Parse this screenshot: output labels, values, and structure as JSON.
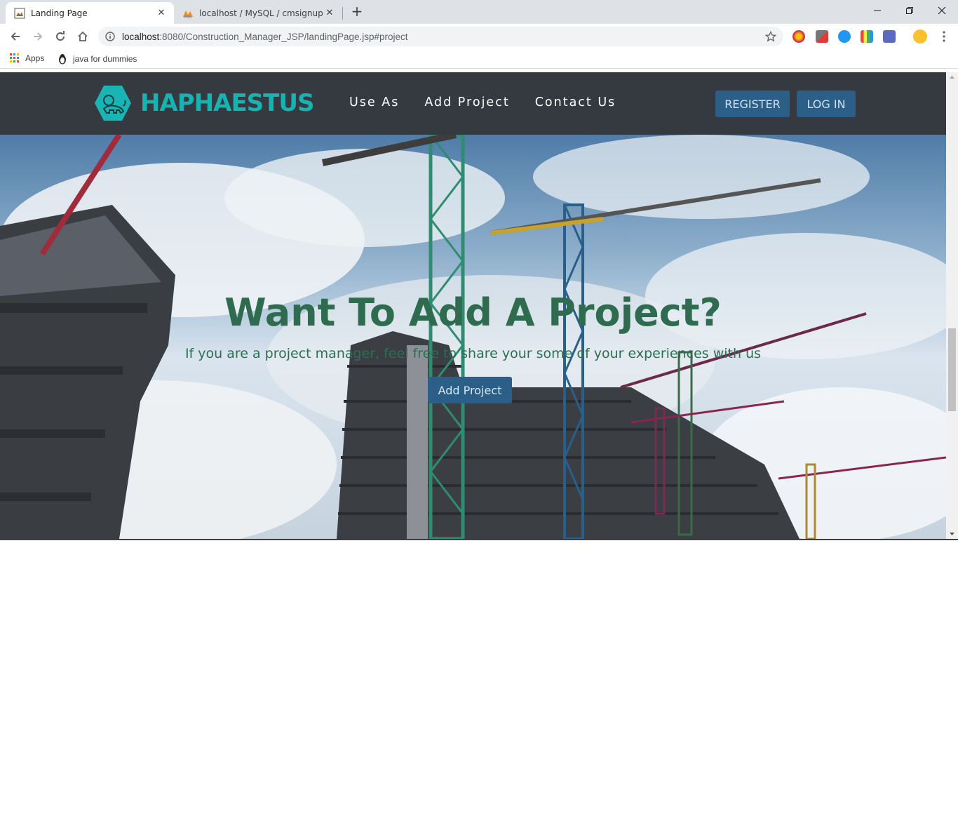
{
  "browser": {
    "tabs": [
      {
        "title": "Landing Page",
        "active": true
      },
      {
        "title": "localhost / MySQL / cmsignup | p",
        "active": false
      }
    ],
    "url_host": "localhost",
    "url_rest": ":8080/Construction_Manager_JSP/landingPage.jsp#project",
    "bookmarks": [
      {
        "label": "Apps",
        "icon": "apps-grid-icon"
      },
      {
        "label": "java for dummies",
        "icon": "penguin-icon"
      }
    ]
  },
  "navbar": {
    "brand": "HAPHAESTUS",
    "links": [
      "Use As",
      "Add Project",
      "Contact Us"
    ],
    "register_label": "REGISTER",
    "login_label": "LOG IN"
  },
  "hero": {
    "title": "Want To Add A Project?",
    "subtitle": "If you are a project manager, feel free to share your some of your experiences with us",
    "button_label": "Add Project"
  },
  "colors": {
    "navbar_bg": "#343a40",
    "brand": "#17b3b3",
    "button": "#2c5f88",
    "hero_text": "#2e6b4f"
  }
}
